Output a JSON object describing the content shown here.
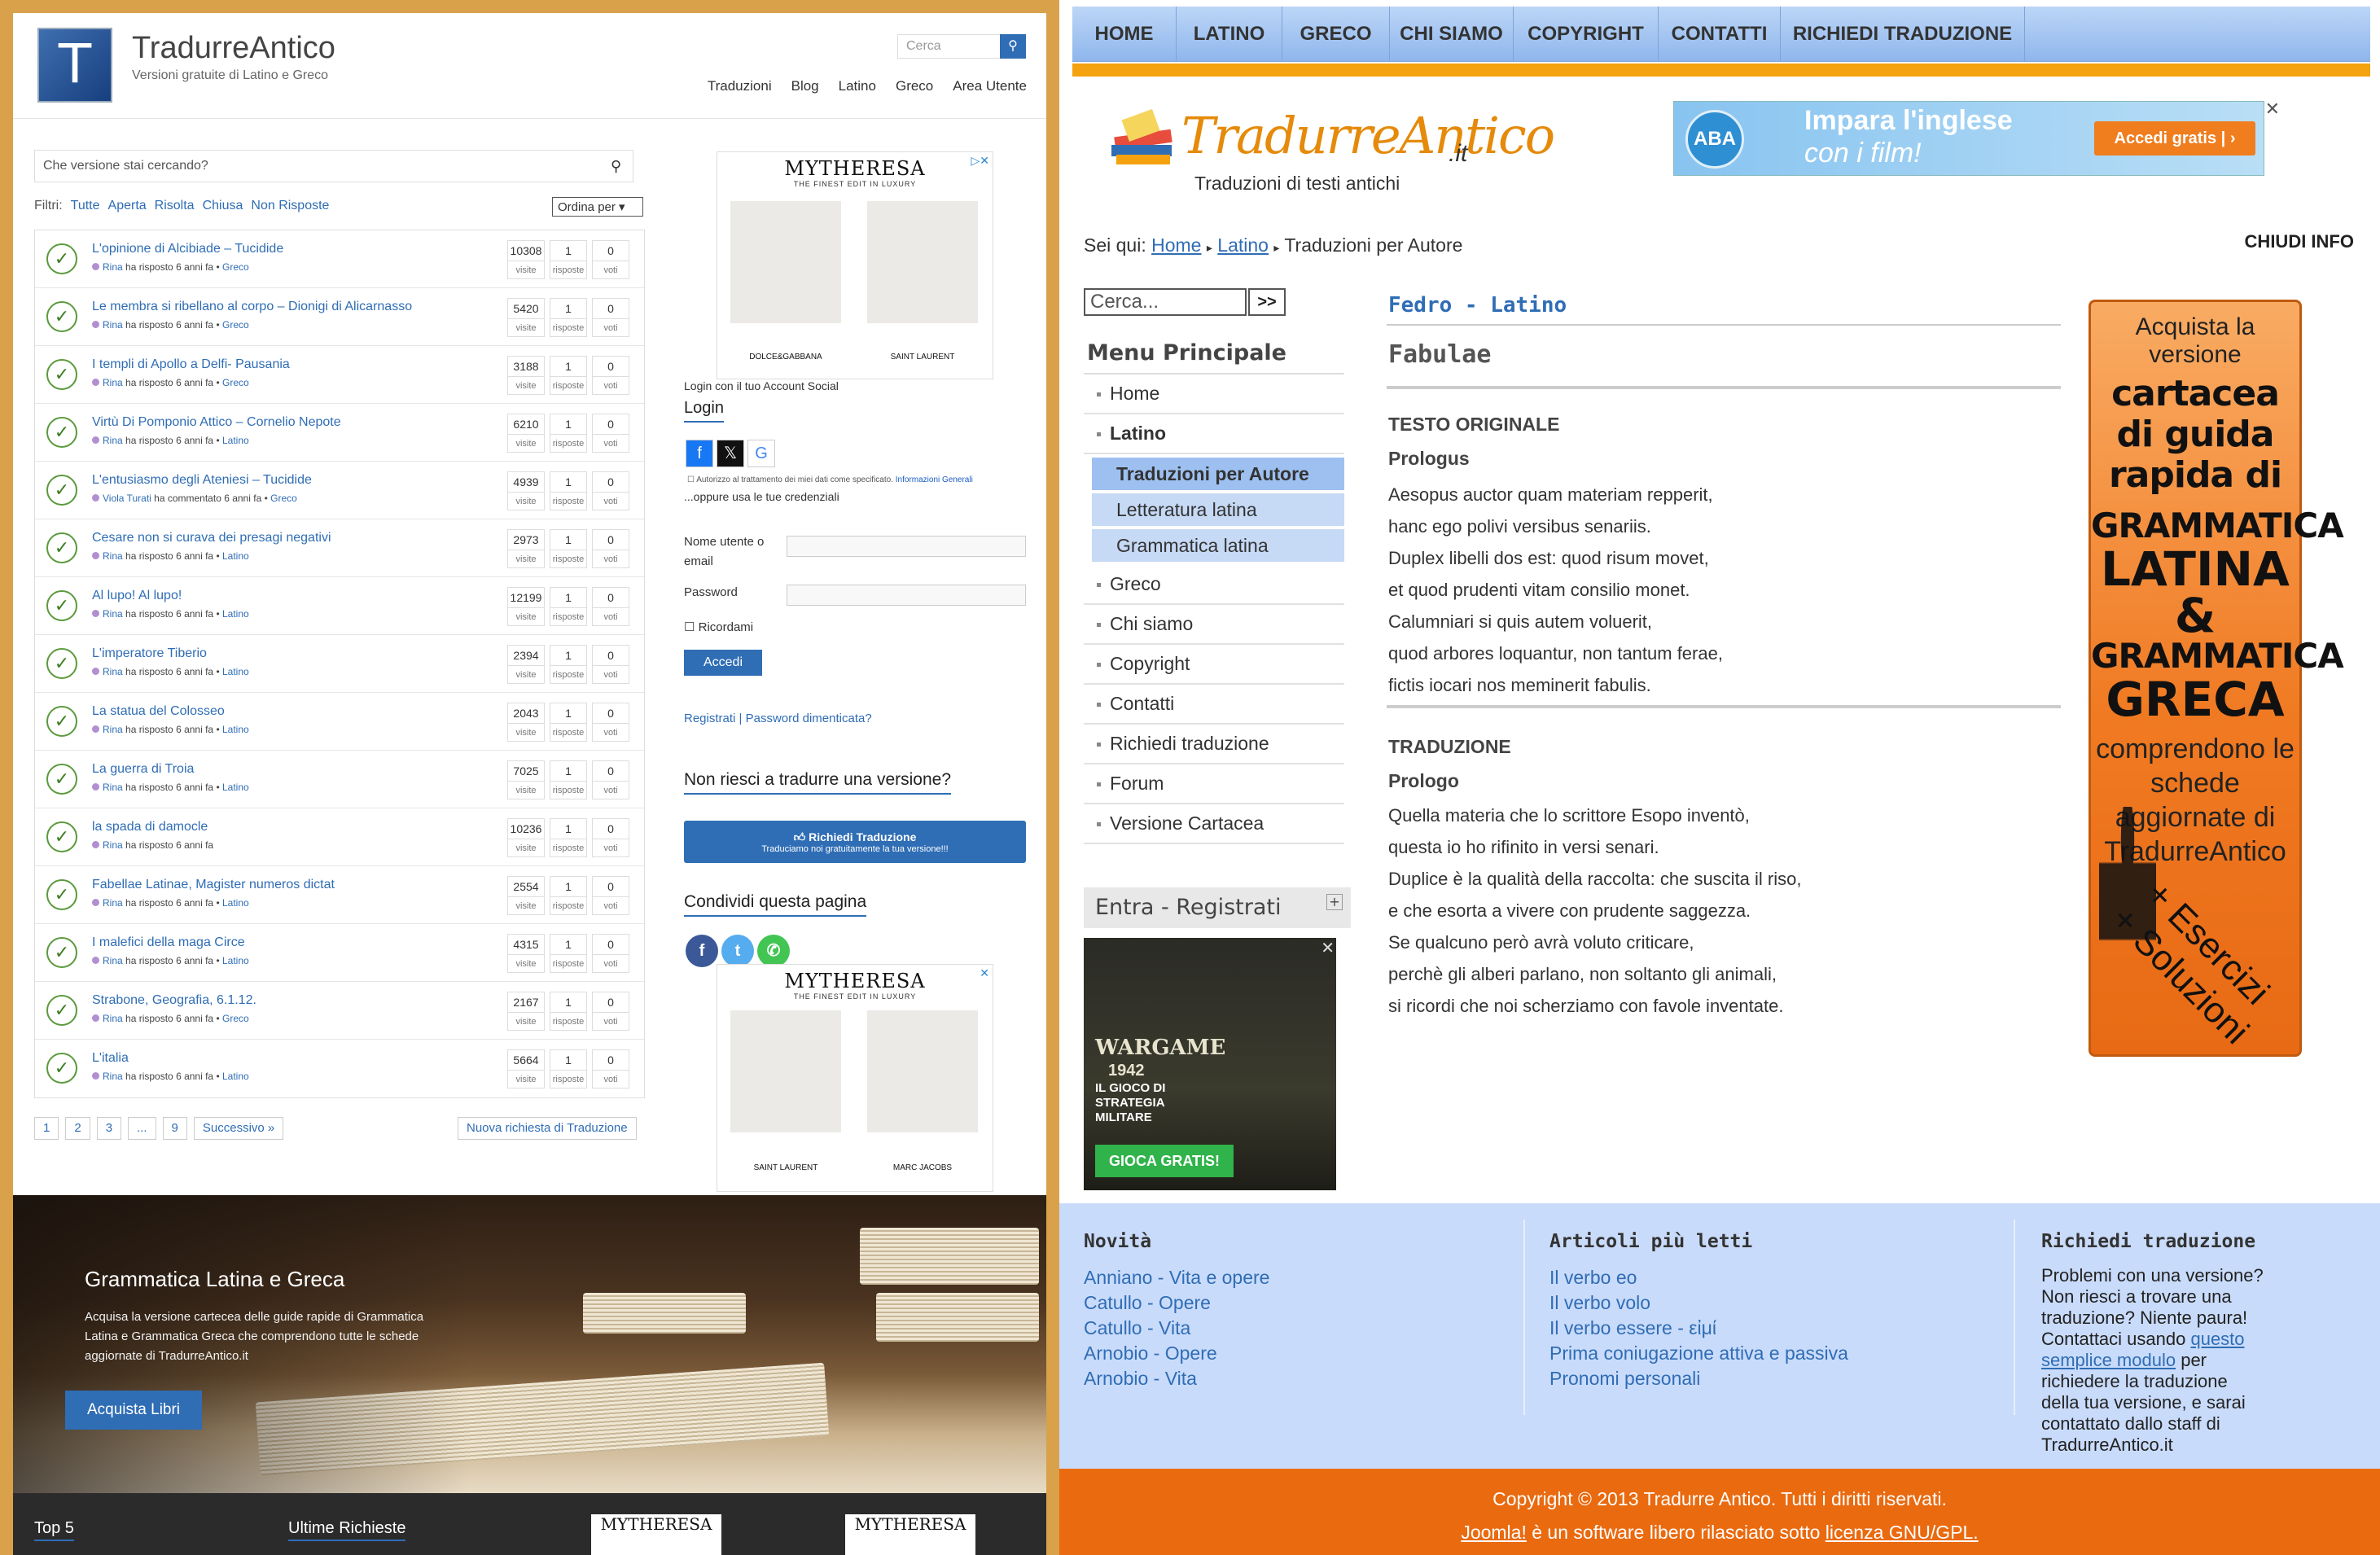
{
  "left": {
    "logo_letter": "T",
    "site_title": "TradurreAntico",
    "site_tagline": "Versioni gratuite di Latino e Greco",
    "search_placeholder": "Cerca",
    "nav": [
      "Traduzioni",
      "Blog",
      "Latino",
      "Greco",
      "Area Utente"
    ],
    "ask_placeholder": "Che versione stai cercando?",
    "filters_label": "Filtri:",
    "filters": [
      "Tutte",
      "Aperta",
      "Risolta",
      "Chiusa",
      "Non Risposte"
    ],
    "order_label": "Ordina per",
    "questions": [
      {
        "title": "L'opinione di Alcibiade – Tucidide",
        "user": "Rina",
        "action": "ha risposto 6 anni fa",
        "cat": "Greco",
        "visits": "10308",
        "answers": "1",
        "votes": "0"
      },
      {
        "title": "Le membra si ribellano al corpo – Dionigi di Alicarnasso",
        "user": "Rina",
        "action": "ha risposto 6 anni fa",
        "cat": "Greco",
        "visits": "5420",
        "answers": "1",
        "votes": "0"
      },
      {
        "title": "I templi di Apollo a Delfi- Pausania",
        "user": "Rina",
        "action": "ha risposto 6 anni fa",
        "cat": "Greco",
        "visits": "3188",
        "answers": "1",
        "votes": "0"
      },
      {
        "title": "Virtù Di Pomponio Attico – Cornelio Nepote",
        "user": "Rina",
        "action": "ha risposto 6 anni fa",
        "cat": "Latino",
        "visits": "6210",
        "answers": "1",
        "votes": "0"
      },
      {
        "title": "L'entusiasmo degli Ateniesi – Tucidide",
        "user": "Viola Turati",
        "action": "ha commentato 6 anni fa",
        "cat": "Greco",
        "visits": "4939",
        "answers": "1",
        "votes": "0"
      },
      {
        "title": "Cesare non si curava dei presagi negativi",
        "user": "Rina",
        "action": "ha risposto 6 anni fa",
        "cat": "Latino",
        "visits": "2973",
        "answers": "1",
        "votes": "0"
      },
      {
        "title": "Al lupo! Al lupo!",
        "user": "Rina",
        "action": "ha risposto 6 anni fa",
        "cat": "Latino",
        "visits": "12199",
        "answers": "1",
        "votes": "0"
      },
      {
        "title": "L'imperatore Tiberio",
        "user": "Rina",
        "action": "ha risposto 6 anni fa",
        "cat": "Latino",
        "visits": "2394",
        "answers": "1",
        "votes": "0"
      },
      {
        "title": "La statua del Colosseo",
        "user": "Rina",
        "action": "ha risposto 6 anni fa",
        "cat": "Latino",
        "visits": "2043",
        "answers": "1",
        "votes": "0"
      },
      {
        "title": "La guerra di Troia",
        "user": "Rina",
        "action": "ha risposto 6 anni fa",
        "cat": "Latino",
        "visits": "7025",
        "answers": "1",
        "votes": "0"
      },
      {
        "title": "la spada di damocle",
        "user": "Rina",
        "action": "ha risposto 6 anni fa",
        "cat": "",
        "visits": "10236",
        "answers": "1",
        "votes": "0"
      },
      {
        "title": "Fabellae Latinae, Magister numeros dictat",
        "user": "Rina",
        "action": "ha risposto 6 anni fa",
        "cat": "Latino",
        "visits": "2554",
        "answers": "1",
        "votes": "0"
      },
      {
        "title": "I malefici della maga Circe",
        "user": "Rina",
        "action": "ha risposto 6 anni fa",
        "cat": "Latino",
        "visits": "4315",
        "answers": "1",
        "votes": "0"
      },
      {
        "title": "Strabone, Geografia, 6.1.12.",
        "user": "Rina",
        "action": "ha risposto 6 anni fa",
        "cat": "Greco",
        "visits": "2167",
        "answers": "1",
        "votes": "0"
      },
      {
        "title": "L'italia",
        "user": "Rina",
        "action": "ha risposto 6 anni fa",
        "cat": "Latino",
        "visits": "5664",
        "answers": "1",
        "votes": "0"
      }
    ],
    "stat_labels": {
      "visits": "visite",
      "answers": "risposte",
      "votes": "voti"
    },
    "pager": [
      "1",
      "2",
      "3",
      "...",
      "9",
      "Successivo »"
    ],
    "new_request": "Nuova richiesta di Traduzione",
    "ad1": {
      "brand": "MYTHERESA",
      "sub": "THE FINEST EDIT IN LUXURY",
      "cap1": "DOLCE&GABBANA",
      "cap2": "SAINT LAURENT"
    },
    "ad2": {
      "brand": "MYTHERESA",
      "sub": "THE FINEST EDIT IN LUXURY",
      "cap1": "SAINT LAURENT",
      "cap2": "MARC JACOBS"
    },
    "login": {
      "social_label": "Login con il tuo Account Social",
      "title": "Login",
      "consent": "Autorizzo al trattamento dei miei dati come specificato.",
      "consent_link": "Informazioni Generali",
      "alt": "...oppure usa le tue credenziali",
      "user_label": "Nome utente o email",
      "pass_label": "Password",
      "remember": "Ricordami",
      "submit": "Accedi",
      "register": "Registrati",
      "forgot": "Password dimenticata?"
    },
    "cant_translate": "Non riesci a tradurre una versione?",
    "req_btn": "Richiedi Traduzione",
    "req_sub": "Traduciamo noi gratuitamente la tua versione!!!",
    "share_title": "Condividi questa pagina",
    "banner": {
      "title": "Grammatica Latina e Greca",
      "text": "Acquisa la versione cartecea delle guide rapide di Grammatica Latina e Grammatica Greca che comprendono tutte le schede aggiornate di TradurreAntico.it",
      "button": "Acquista Libri"
    },
    "footer_titles": [
      "Top 5",
      "Ultime Richieste"
    ],
    "colors": {
      "accent": "#2f6db5",
      "check": "#5a9a3c"
    }
  },
  "right": {
    "nav": [
      "HOME",
      "LATINO",
      "GRECO",
      "CHI SIAMO",
      "COPYRIGHT",
      "CONTATTI",
      "RICHIEDI TRADUZIONE"
    ],
    "logo_main": "TradurreAntico",
    "logo_tld": ".it",
    "logo_tag": "Traduzioni di testi antichi",
    "aba": {
      "badge": "ABA",
      "line1": "Impara l'inglese",
      "line2": "con i film!",
      "button": "Accedi gratis  |  ›"
    },
    "crumb": {
      "prefix": "Sei qui:",
      "home": "Home",
      "latino": "Latino",
      "current": "Traduzioni per Autore"
    },
    "close_info": "CHIUDI INFO",
    "search_placeholder": "Cerca...",
    "search_btn": ">>",
    "menu_title": "Menu Principale",
    "menu": [
      "Home",
      "Latino",
      "Greco",
      "Chi siamo",
      "Copyright",
      "Contatti",
      "Richiedi traduzione",
      "Forum",
      "Versione Cartacea"
    ],
    "submenu": [
      "Traduzioni per Autore",
      "Letteratura latina",
      "Grammatica latina"
    ],
    "entra": "Entra - Registrati",
    "war": {
      "title": "WARGAME",
      "year": "1942",
      "text": "IL GIOCO DI STRATEGIA MILITARE",
      "button": "GIOCA GRATIS!"
    },
    "article": {
      "category": "Fedro - Latino",
      "title": "Fabulae",
      "orig_head": "TESTO ORIGINALE",
      "orig_sub": "Prologus",
      "orig_lines": [
        "Aesopus auctor quam materiam repperit,",
        "hanc ego polivi versibus senariis.",
        "Duplex libelli dos est: quod risum movet,",
        "et quod prudenti vitam consilio monet.",
        "Calumniari si quis autem voluerit,",
        "quod arbores loquantur, non tantum ferae,",
        "fictis iocari nos meminerit fabulis."
      ],
      "trad_head": "TRADUZIONE",
      "trad_sub": "Prologo",
      "trad_lines": [
        "Quella materia che lo scrittore Esopo inventò,",
        "questa io ho rifinito in versi senari.",
        "Duplice è la qualità della raccolta: che suscita il riso,",
        "e che esorta a vivere con prudente saggezza.",
        "Se qualcuno però avrà voluto criticare,",
        "perchè gli alberi parlano, non soltanto gli animali,",
        "si ricordi che noi scherziamo con favole inventate."
      ]
    },
    "promo": {
      "p1": "Acquista la versione",
      "p2": "cartacea di guida rapida di",
      "p3": "GRAMMATICA",
      "p3b": "LATINA",
      "amp": "&",
      "p3c": "GRAMMATICA",
      "p3d": "GRECA",
      "p4": "comprendono le schede aggiornate di TradurreAntico",
      "p5a": "+ Esercizi",
      "p5b": "+ Soluzioni"
    },
    "footer": {
      "news_title": "Novità",
      "news": [
        "Anniano - Vita e opere",
        "Catullo - Opere",
        "Catullo - Vita",
        "Arnobio - Opere",
        "Arnobio - Vita"
      ],
      "read_title": "Articoli più letti",
      "read": [
        "Il verbo eo",
        "Il verbo volo",
        "Il verbo essere - εἰμί",
        "Prima coniugazione attiva e passiva",
        "Pronomi personali"
      ],
      "req_title": "Richiedi traduzione",
      "req_text1": "Problemi con una versione? Non riesci a trovare una traduzione? Niente paura! Contattaci usando",
      "req_link": "questo semplice modulo",
      "req_text2": "per richiedere la traduzione della tua versione, e sarai contattato dallo staff di TradurreAntico.it"
    },
    "copyright1": "Copyright © 2013 Tradurre Antico. Tutti i diritti riservati.",
    "copy_joomla": "Joomla!",
    "copy_mid": "è un software libero rilasciato sotto",
    "copy_license": "licenza GNU/GPL.",
    "colors": {
      "nav": "#9dc0f0",
      "bar": "#f4a20f",
      "footer": "#c9dbfa",
      "copyright": "#ea6a0f"
    }
  }
}
